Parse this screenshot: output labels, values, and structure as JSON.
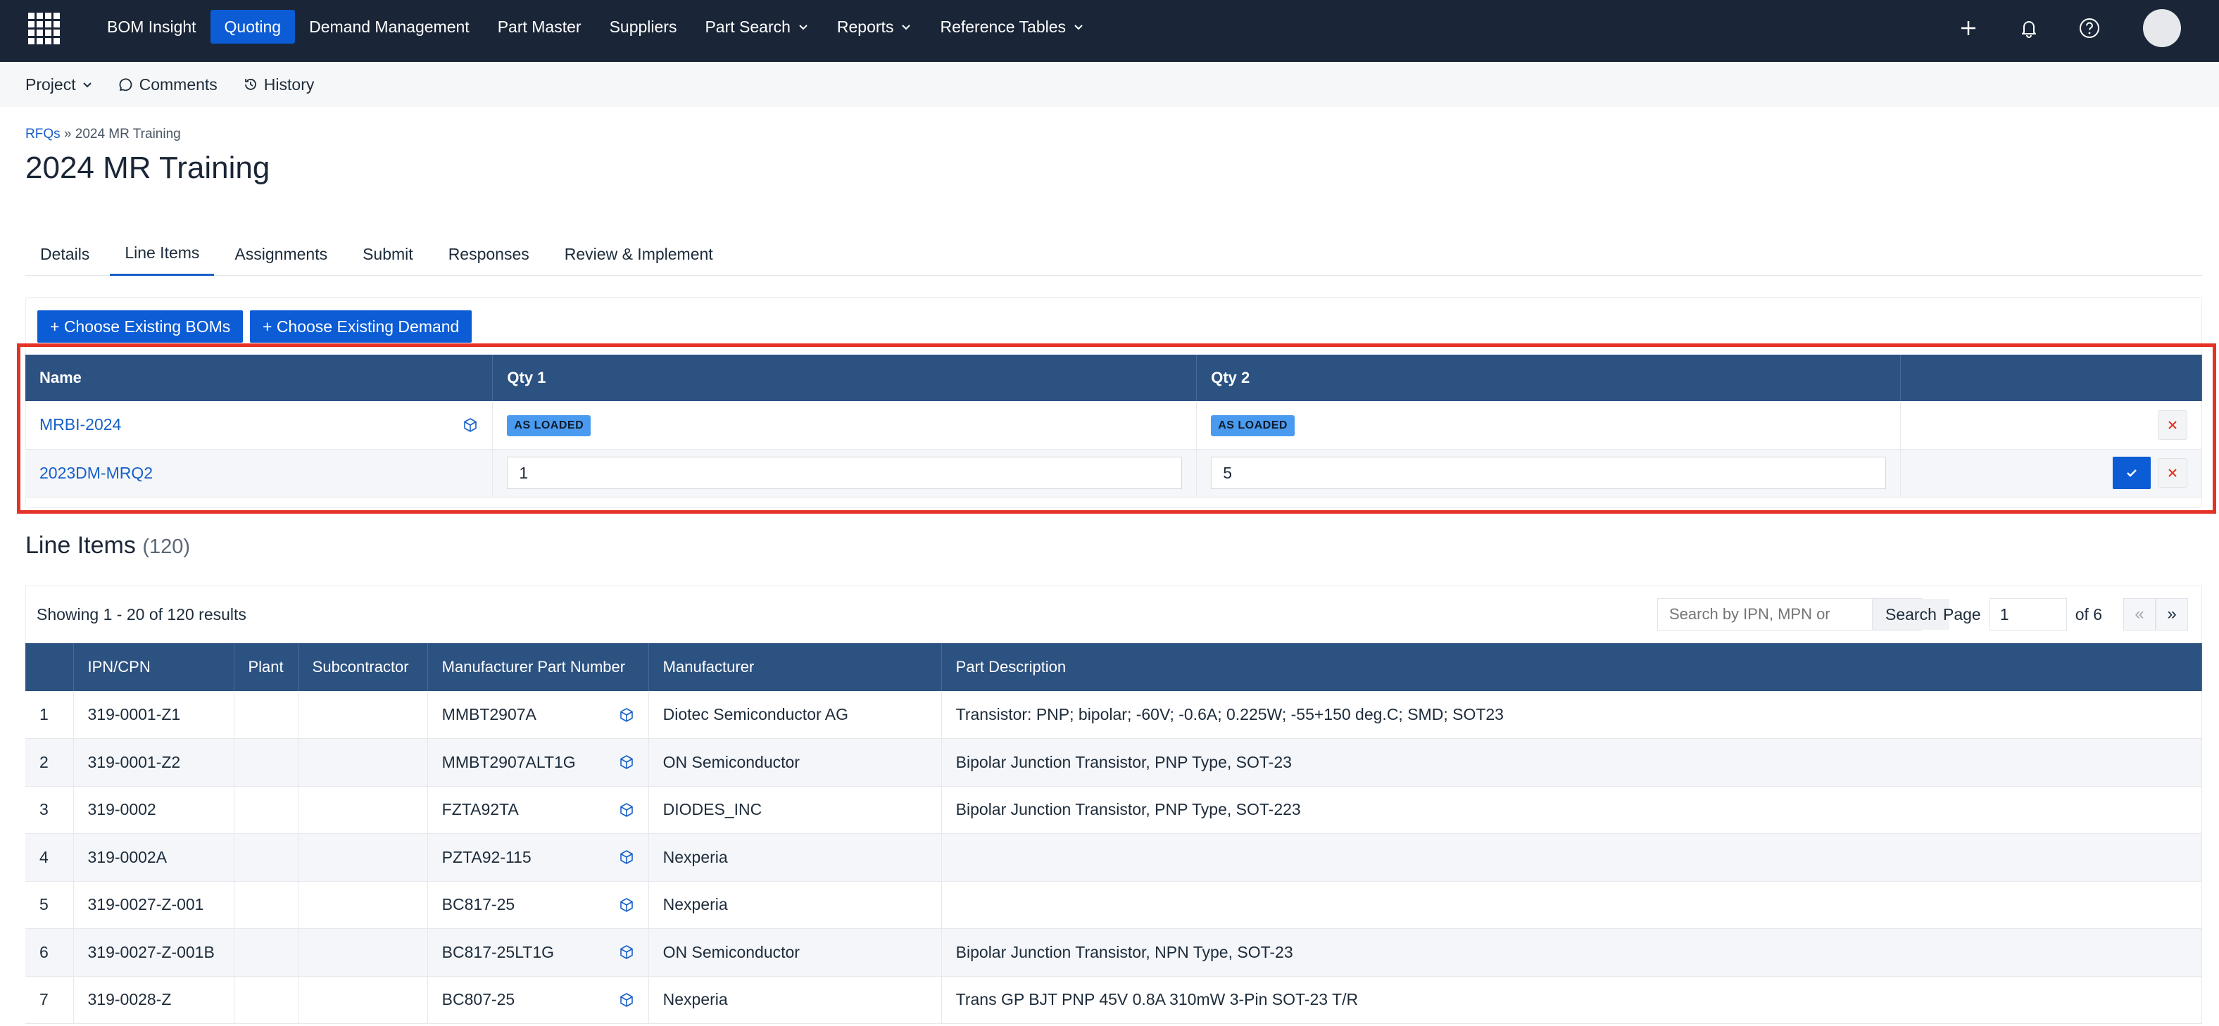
{
  "nav": {
    "items": [
      {
        "label": "BOM Insight",
        "active": false,
        "dropdown": false
      },
      {
        "label": "Quoting",
        "active": true,
        "dropdown": false
      },
      {
        "label": "Demand Management",
        "active": false,
        "dropdown": false
      },
      {
        "label": "Part Master",
        "active": false,
        "dropdown": false
      },
      {
        "label": "Suppliers",
        "active": false,
        "dropdown": false
      },
      {
        "label": "Part Search",
        "active": false,
        "dropdown": true
      },
      {
        "label": "Reports",
        "active": false,
        "dropdown": true
      },
      {
        "label": "Reference Tables",
        "active": false,
        "dropdown": true
      }
    ],
    "right_icons": [
      "plus-icon",
      "bell-icon",
      "help-icon"
    ]
  },
  "subbar": {
    "project": "Project",
    "comments": "Comments",
    "history": "History"
  },
  "breadcrumb": {
    "root": "RFQs",
    "separator": "»",
    "current": "2024 MR Training"
  },
  "page_title": "2024 MR Training",
  "tabs": [
    {
      "label": "Details",
      "active": false
    },
    {
      "label": "Line Items",
      "active": true
    },
    {
      "label": "Assignments",
      "active": false
    },
    {
      "label": "Submit",
      "active": false
    },
    {
      "label": "Responses",
      "active": false
    },
    {
      "label": "Review & Implement",
      "active": false
    }
  ],
  "bom_panel": {
    "choose_boms": "+ Choose Existing BOMs",
    "choose_demand": "+ Choose Existing Demand",
    "columns": [
      "Name",
      "Qty 1",
      "Qty 2",
      ""
    ],
    "rows": [
      {
        "name": "MRBI-2024",
        "qty1": "AS LOADED",
        "qty2": "AS LOADED"
      },
      {
        "name": "2023DM-MRQ2",
        "qty1": "1",
        "qty2": "5"
      }
    ]
  },
  "line_items": {
    "heading": "Line Items",
    "count": "(120)",
    "showing": "Showing 1 - 20 of 120 results",
    "search_placeholder": "Search by IPN, MPN or",
    "search_button": "Search",
    "page_label": "Page",
    "page_value": "1",
    "page_of": "of 6",
    "prev": "«",
    "next": "»",
    "columns": [
      "",
      "IPN/CPN",
      "Plant",
      "Subcontractor",
      "Manufacturer Part Number",
      "Manufacturer",
      "Part Description"
    ],
    "rows": [
      {
        "n": "1",
        "ipn": "319-0001-Z1",
        "mpn": "MMBT2907A",
        "mfr": "Diotec Semiconductor AG",
        "desc": "Transistor: PNP; bipolar; -60V; -0.6A; 0.225W; -55+150 deg.C; SMD; SOT23"
      },
      {
        "n": "2",
        "ipn": "319-0001-Z2",
        "mpn": "MMBT2907ALT1G",
        "mfr": "ON Semiconductor",
        "desc": "Bipolar Junction Transistor, PNP Type, SOT-23"
      },
      {
        "n": "3",
        "ipn": "319-0002",
        "mpn": "FZTA92TA",
        "mfr": "DIODES_INC",
        "desc": "Bipolar Junction Transistor, PNP Type, SOT-223"
      },
      {
        "n": "4",
        "ipn": "319-0002A",
        "mpn": "PZTA92-115",
        "mfr": "Nexperia",
        "desc": ""
      },
      {
        "n": "5",
        "ipn": "319-0027-Z-001",
        "mpn": "BC817-25",
        "mfr": "Nexperia",
        "desc": ""
      },
      {
        "n": "6",
        "ipn": "319-0027-Z-001B",
        "mpn": "BC817-25LT1G",
        "mfr": "ON Semiconductor",
        "desc": "Bipolar Junction Transistor, NPN Type, SOT-23"
      },
      {
        "n": "7",
        "ipn": "319-0028-Z",
        "mpn": "BC807-25",
        "mfr": "Nexperia",
        "desc": "Trans GP BJT PNP 45V 0.8A 310mW 3-Pin SOT-23 T/R"
      }
    ]
  },
  "colors": {
    "nav_bg": "#1a2637",
    "accent": "#0b5cd5",
    "table_header": "#2c5282",
    "highlight_border": "#e53226",
    "badge": "#4a9bf0"
  }
}
